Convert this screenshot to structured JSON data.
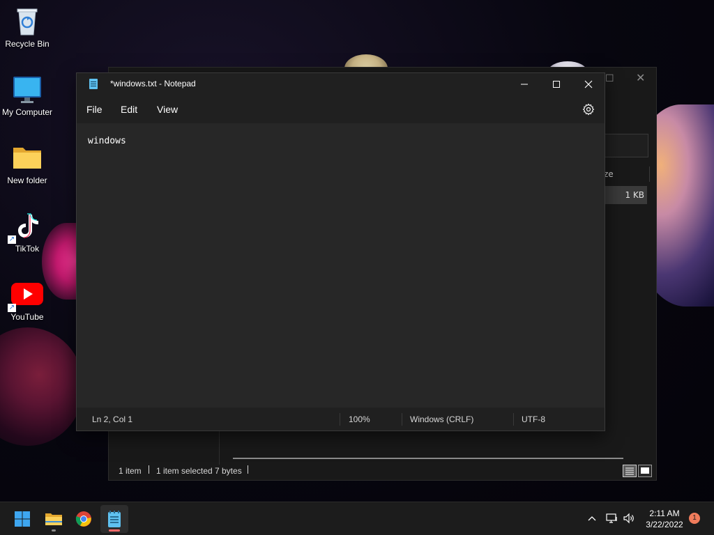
{
  "desktop": {
    "icons": [
      {
        "label": "Recycle Bin",
        "icon": "recycle-bin-icon"
      },
      {
        "label": "My Computer",
        "icon": "monitor-icon"
      },
      {
        "label": "New folder",
        "icon": "folder-icon"
      },
      {
        "label": "TikTok",
        "icon": "tiktok-icon"
      },
      {
        "label": "YouTube",
        "icon": "youtube-icon"
      }
    ]
  },
  "explorer": {
    "column_header": "ze",
    "selected_row_size": "1 KB",
    "status": {
      "items": "1 item",
      "selected": "1 item selected",
      "size": "7 bytes"
    }
  },
  "notepad": {
    "title": "*windows.txt - Notepad",
    "menu": {
      "file": "File",
      "edit": "Edit",
      "view": "View"
    },
    "content": "windows",
    "status": {
      "position": "Ln 2, Col 1",
      "zoom": "100%",
      "line_ending": "Windows (CRLF)",
      "encoding": "UTF-8"
    }
  },
  "taskbar": {
    "apps": [
      "start-icon",
      "file-explorer-icon",
      "chrome-icon",
      "notepad-icon"
    ],
    "active_app": "notepad-icon",
    "time": "2:11 AM",
    "date": "3/22/2022",
    "notification_count": "1"
  },
  "colors": {
    "accent_notification": "#f07c5c",
    "notepad_bg": "#272727",
    "taskbar_bg": "#1c1c1c"
  }
}
